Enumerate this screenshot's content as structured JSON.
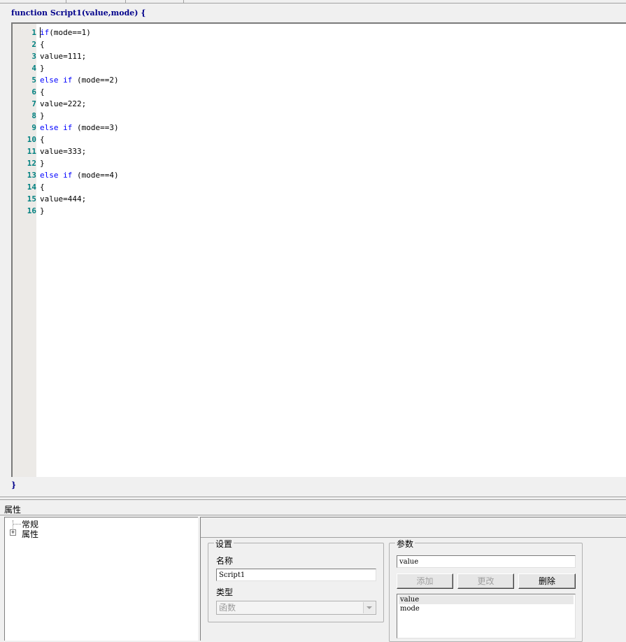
{
  "editor": {
    "header": "function Script1(value,mode) {",
    "footer": "}",
    "lines": [
      {
        "n": "1",
        "kw": "if",
        "rest": "(mode==1)"
      },
      {
        "n": "2",
        "kw": "",
        "rest": "{"
      },
      {
        "n": "3",
        "kw": "",
        "rest": "value=111;"
      },
      {
        "n": "4",
        "kw": "",
        "rest": "}"
      },
      {
        "n": "5",
        "kw": "else if",
        "rest": " (mode==2)"
      },
      {
        "n": "6",
        "kw": "",
        "rest": "{"
      },
      {
        "n": "7",
        "kw": "",
        "rest": "value=222;"
      },
      {
        "n": "8",
        "kw": "",
        "rest": "}"
      },
      {
        "n": "9",
        "kw": "else if",
        "rest": " (mode==3)"
      },
      {
        "n": "10",
        "kw": "",
        "rest": "{"
      },
      {
        "n": "11",
        "kw": "",
        "rest": "value=333;"
      },
      {
        "n": "12",
        "kw": "",
        "rest": "}"
      },
      {
        "n": "13",
        "kw": "else if",
        "rest": " (mode==4)"
      },
      {
        "n": "14",
        "kw": "",
        "rest": "{"
      },
      {
        "n": "15",
        "kw": "",
        "rest": "value=444;"
      },
      {
        "n": "16",
        "kw": "",
        "rest": "}"
      }
    ]
  },
  "properties": {
    "title": "属性",
    "tree": {
      "general": "常规",
      "attributes": "属性",
      "expander": "+"
    },
    "settings": {
      "legend": "设置",
      "name_label": "名称",
      "name_value": "Script1",
      "type_label": "类型",
      "type_value": "函数"
    },
    "params": {
      "legend": "参数",
      "input_value": "value",
      "add_label": "添加",
      "modify_label": "更改",
      "delete_label": "删除",
      "items": [
        "value",
        "mode"
      ]
    }
  }
}
